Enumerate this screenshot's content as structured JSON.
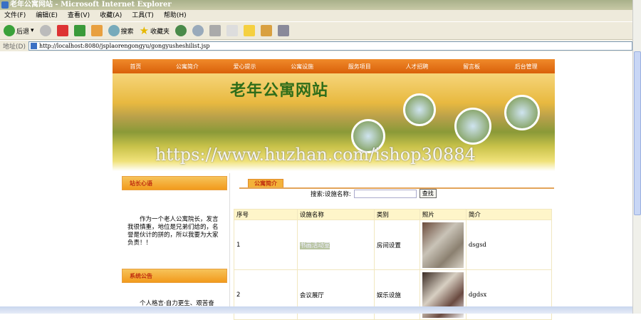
{
  "window": {
    "title": "老年公寓网站 - Microsoft Internet Explorer"
  },
  "menu": [
    "文件(F)",
    "编辑(E)",
    "查看(V)",
    "收藏(A)",
    "工具(T)",
    "帮助(H)"
  ],
  "toolbar": {
    "back": "后退",
    "search": "搜索",
    "favorites": "收藏夹"
  },
  "address": {
    "label": "地址(D)",
    "url": "http://localhost:8080/jsplaorengongyu/gongyusheshilist.jsp"
  },
  "nav": [
    "首页",
    "公寓简介",
    "爱心提示",
    "公寓设施",
    "服务项目",
    "人才招聘",
    "留言板",
    "后台管理"
  ],
  "banner": {
    "title": "老年公寓网站",
    "watermark": "https://www.huzhan.com/ishop30884"
  },
  "sidebar": {
    "sec1_title": "站长心语",
    "sec1_text": "作为一个老人公寓院长，发言我很慎重，地位是兄弟们给的，名誉是伙计的拼的，所以我要为大家负责！！",
    "sec2_title": "系统公告",
    "sec2_text": "个人格言·自力更生、艰苦奋"
  },
  "main": {
    "tab": "公寓简介",
    "search_label": "搜索:设施名称:",
    "search_value": "",
    "search_button": "查找",
    "columns": [
      "序号",
      "设施名称",
      "类别",
      "照片",
      "简介"
    ],
    "rows": [
      {
        "no": "1",
        "name": "书画活动室",
        "type": "房间设置",
        "desc": "dsgsd"
      },
      {
        "no": "2",
        "name": "会议展厅",
        "type": "娱乐设施",
        "desc": "dgdsx"
      }
    ]
  }
}
